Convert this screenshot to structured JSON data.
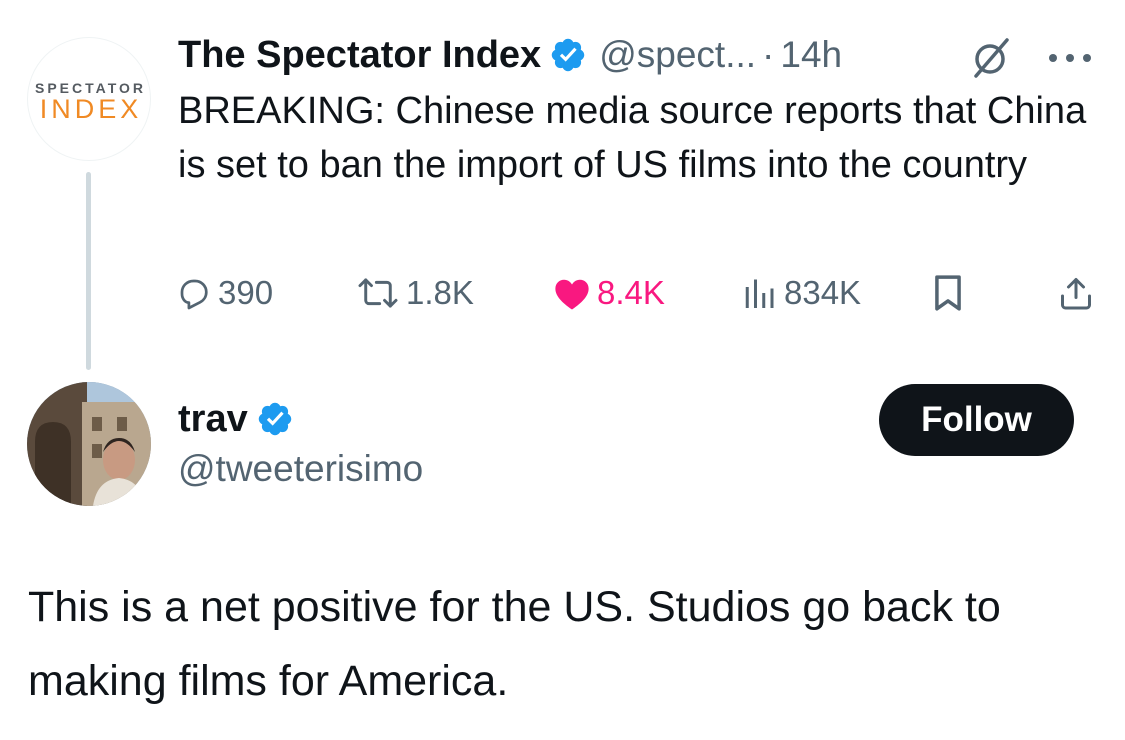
{
  "parent_tweet": {
    "logo_top": "SPECTATOR",
    "logo_bottom": "INDEX",
    "display_name": "The Spectator Index",
    "handle": "@spect...",
    "separator": "·",
    "time": "14h",
    "text": "BREAKING: Chinese media source reports that China is set to ban the import of US films into the country",
    "actions": {
      "replies": "390",
      "reposts": "1.8K",
      "likes": "8.4K",
      "views": "834K"
    },
    "colors": {
      "like_active": "#f91880",
      "verified": "#1d9bf0",
      "logo_orange": "#f08a24"
    }
  },
  "reply_tweet": {
    "display_name": "trav",
    "handle": "@tweeterisimo",
    "follow_label": "Follow",
    "text": "This is a net positive for the US. Studios go back to making films for America."
  }
}
